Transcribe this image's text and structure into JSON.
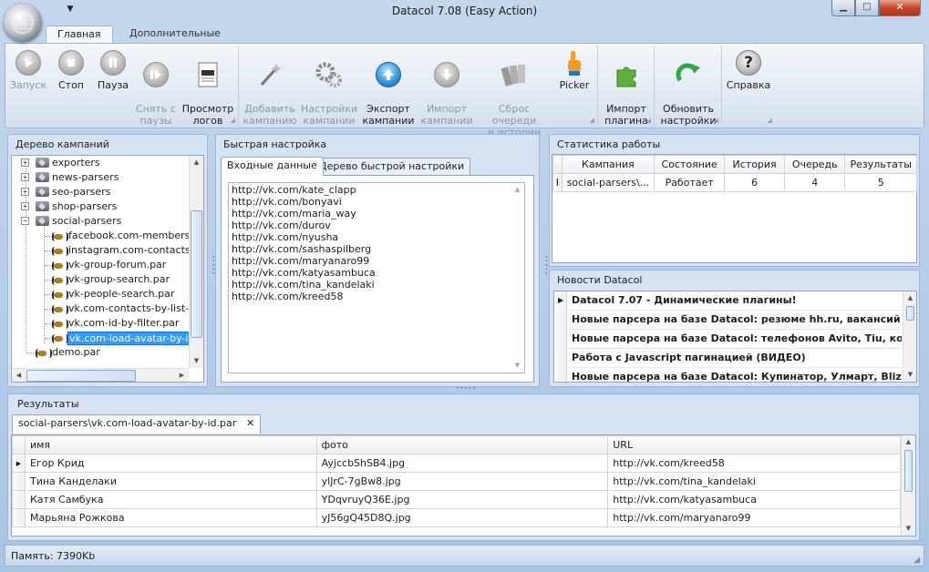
{
  "window": {
    "title": "Datacol 7.08 (Easy Action)",
    "qat_icon": "dropdown-arrow-icon",
    "min_glyph": "▁",
    "max_glyph": "□",
    "close_glyph": "✕"
  },
  "ribbon_tabs": [
    {
      "label": "Главная",
      "active": true
    },
    {
      "label": "Дополнительные",
      "active": false
    }
  ],
  "ribbon": {
    "run": {
      "label": "Запуск",
      "icon": "play-icon",
      "enabled": false
    },
    "stop": {
      "label": "Стоп",
      "icon": "stop-icon",
      "enabled": true
    },
    "pause": {
      "label": "Пауза",
      "icon": "pause-icon",
      "enabled": true
    },
    "unpause": {
      "label": "Снять с\nпаузы",
      "icon": "resume-icon",
      "enabled": false
    },
    "logs": {
      "label": "Просмотр\nлогов",
      "icon": "log-document-icon",
      "enabled": true
    },
    "add_campaign": {
      "label": "Добавить\nкампанию",
      "icon": "magic-wand-icon",
      "enabled": false
    },
    "campaign_settings": {
      "label": "Настройки\nкампании",
      "icon": "gears-icon",
      "enabled": false
    },
    "export_campaign": {
      "label": "Экспорт\nкампании",
      "icon": "export-arrow-up-icon",
      "enabled": true
    },
    "import_campaign": {
      "label": "Импорт\nкампании",
      "icon": "import-arrow-down-icon",
      "enabled": false
    },
    "reset_queue": {
      "label": "Сброс очереди\nи истории",
      "icon": "reset-queue-icon",
      "enabled": false
    },
    "picker": {
      "label": "Picker",
      "icon": "picker-hand-icon",
      "enabled": true
    },
    "import_plugin": {
      "label": "Импорт\nплагина",
      "icon": "puzzle-icon",
      "enabled": true
    },
    "update_settings": {
      "label": "Обновить\nнастройки",
      "icon": "refresh-icon",
      "enabled": true
    },
    "help": {
      "label": "Справка",
      "icon": "help-icon",
      "enabled": true,
      "glyph": "?"
    }
  },
  "campaign_tree": {
    "title": "Дерево кампаний",
    "folders": [
      "exporters",
      "news-parsers",
      "seo-parsers",
      "shop-parsers",
      "social-parsers"
    ],
    "social_children": [
      "facebook.com-members-of",
      "instagram.com-contacts-by",
      "vk-group-forum.par",
      "vk-group-search.par",
      "vk-people-search.par",
      "vk.com-contacts-by-list-of-",
      "vk.com-id-by-filter.par",
      "vk.com-load-avatar-by-id.p"
    ],
    "selected_index": 7,
    "root_file": "demo.par"
  },
  "quick_setup": {
    "title": "Быстрая настройка",
    "tabs": [
      "Входные данные",
      "Дерево быстрой настройки"
    ],
    "active_tab": 0,
    "input_lines": [
      "http://vk.com/kate_clapp",
      "http://vk.com/bonyavi",
      "http://vk.com/maria_way",
      "http://vk.com/durov",
      "http://vk.com/nyusha",
      "http://vk.com/sashaspilberg",
      "http://vk.com/maryanaro99",
      "http://vk.com/katyasambuca",
      "http://vk.com/tina_kandelaki",
      "http://vk.com/kreed58"
    ]
  },
  "stats": {
    "title": "Статистика работы",
    "columns": [
      "Кампания",
      "Состояние",
      "История",
      "Очередь",
      "Результаты"
    ],
    "rows": [
      {
        "campaign": "social-parsers\\...",
        "state": "Работает",
        "history": "6",
        "queue": "4",
        "results": "5",
        "marker": "I"
      }
    ]
  },
  "news": {
    "title": "Новости Datacol",
    "items": [
      "Datacol 7.07 - Динамические плагины!",
      "Новые парсера на базе Datacol: резюме hh.ru, вакансий hh....",
      "Новые парсера на базе Datacol: телефонов Avito, Tiu, конт...",
      "Работа с Javascript пагинацией (ВИДЕО)",
      "Новые парсера на базе Datacol: Купинатор, Улмарт, Blizko,..."
    ]
  },
  "results": {
    "title": "Результаты",
    "doc_tab": "social-parsers\\vk.com-load-avatar-by-id.par",
    "doc_tab_close": "✕",
    "columns": [
      "имя",
      "фото",
      "URL"
    ],
    "rows": [
      {
        "name": "Егор Крид",
        "photo": "AyjccbShSB4.jpg",
        "url": "http://vk.com/kreed58"
      },
      {
        "name": "Тина Канделаки",
        "photo": "ylJrC-7gBw8.jpg",
        "url": "http://vk.com/tina_kandelaki"
      },
      {
        "name": "Катя Самбука",
        "photo": "YDqvruyQ36E.jpg",
        "url": "http://vk.com/katyasambuca"
      },
      {
        "name": "Марьяна Рожкова",
        "photo": "yJ56gQ45D8Q.jpg",
        "url": "http://vk.com/maryanaro99"
      }
    ]
  },
  "status": {
    "memory": "Память: 7390Kb"
  },
  "colors": {
    "accent": "#3399ff",
    "frame": "#b9d1ea",
    "panel": "#d6e3f3"
  }
}
